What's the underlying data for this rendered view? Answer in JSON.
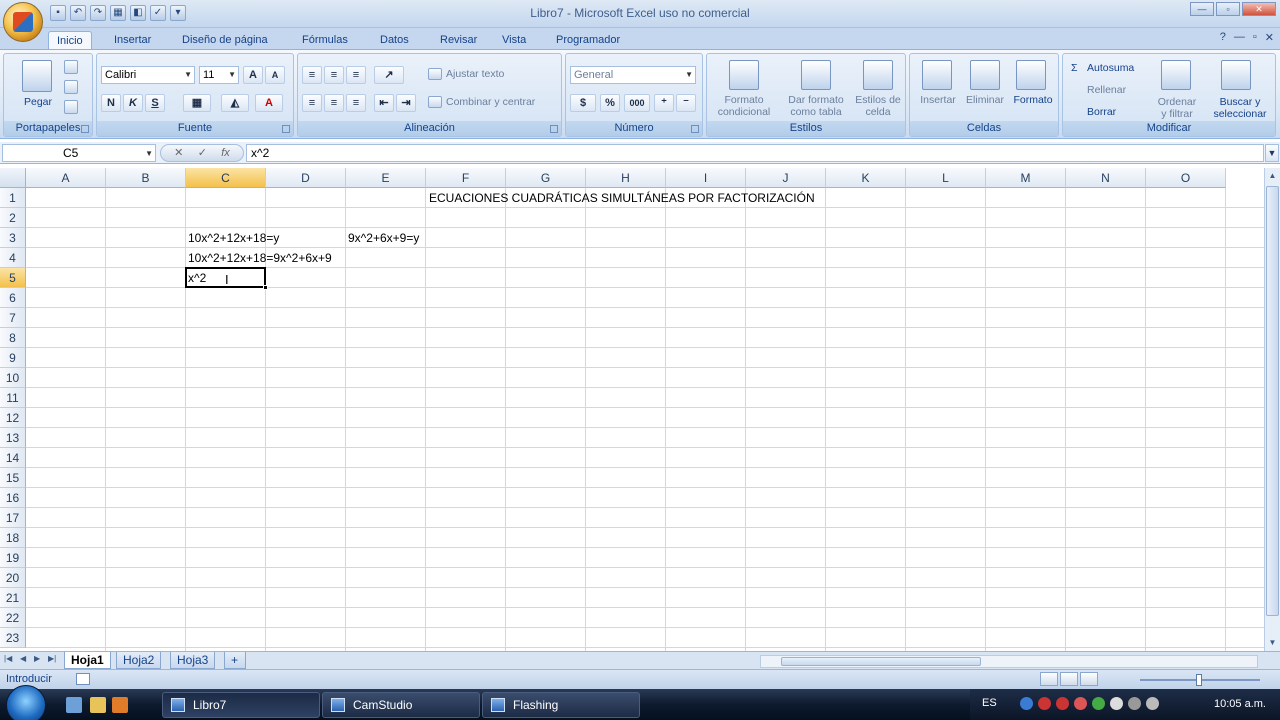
{
  "window": {
    "title": "Libro7 - Microsoft Excel uso no comercial"
  },
  "ribbon_tabs": [
    "Inicio",
    "Insertar",
    "Diseño de página",
    "Fórmulas",
    "Datos",
    "Revisar",
    "Vista",
    "Programador"
  ],
  "clipboard": {
    "paste_label": "Pegar",
    "group": "Portapapeles"
  },
  "font": {
    "name": "Calibri",
    "size": "11",
    "bold": "N",
    "italic": "K",
    "underline": "S",
    "group": "Fuente"
  },
  "alignment": {
    "wrap": "Ajustar texto",
    "merge": "Combinar y centrar",
    "group": "Alineación"
  },
  "number": {
    "format": "General",
    "currency": "$",
    "percent": "%",
    "thousands": "000",
    "group": "Número"
  },
  "styles": {
    "conditional": "Formato\ncondicional",
    "as_table": "Dar formato\ncomo tabla",
    "cell_styles": "Estilos de\ncelda",
    "group": "Estilos"
  },
  "cells": {
    "insert": "Insertar",
    "delete": "Eliminar",
    "format": "Formato",
    "group": "Celdas"
  },
  "editing": {
    "autosum": "Autosuma",
    "fill": "Rellenar",
    "clear": "Borrar",
    "sort": "Ordenar\ny filtrar",
    "find": "Buscar y\nseleccionar",
    "group": "Modificar"
  },
  "formula_bar": {
    "name_box": "C5",
    "content": "x^2",
    "fx": "fx"
  },
  "columns": [
    "A",
    "B",
    "C",
    "D",
    "E",
    "F",
    "G",
    "H",
    "I",
    "J",
    "K",
    "L",
    "M",
    "N",
    "O"
  ],
  "selected_column": "C",
  "rows": [
    "1",
    "2",
    "3",
    "4",
    "5",
    "6",
    "7",
    "8",
    "9",
    "10",
    "11",
    "12",
    "13",
    "14",
    "15",
    "16",
    "17",
    "18",
    "19",
    "20",
    "21",
    "22",
    "23"
  ],
  "selected_row": "5",
  "cell_values": {
    "F1": "ECUACIONES CUADRÁTICAS SIMULTÁNEAS POR FACTORIZACIÓN",
    "C3": "10x^2+12x+18=y",
    "E3": "9x^2+6x+9=y",
    "C4": "10x^2+12x+18=9x^2+6x+9",
    "C5": "x^2"
  },
  "sheet_tabs": [
    "Hoja1",
    "Hoja2",
    "Hoja3"
  ],
  "active_sheet": "Hoja1",
  "status": {
    "mode": "Introducir"
  },
  "taskbar": {
    "tasks": [
      "Libro7",
      "CamStudio",
      "Flashing"
    ],
    "lang": "ES",
    "clock": "10:05 a.m."
  }
}
